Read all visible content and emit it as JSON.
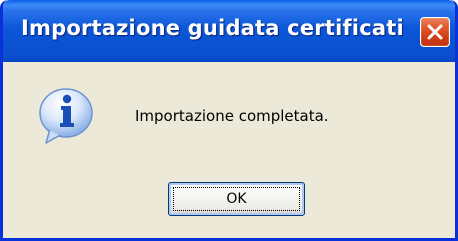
{
  "window": {
    "title": "Importazione guidata certificati"
  },
  "dialog": {
    "icon": "info-icon",
    "message": "Importazione completata.",
    "ok_label": "OK"
  },
  "colors": {
    "titlebar": "#0a52d2",
    "window_border": "#0831d9",
    "close_button": "#e2562b",
    "body_background": "#ece9d8"
  }
}
